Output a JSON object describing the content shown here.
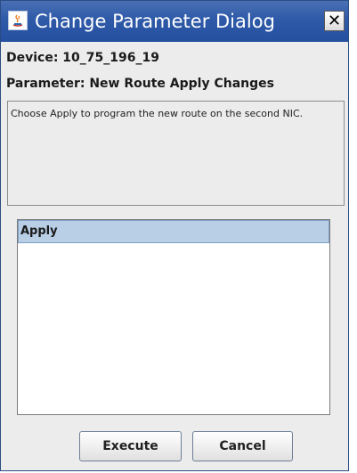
{
  "window": {
    "title": "Change Parameter Dialog",
    "close_glyph": "✕",
    "icon": "java-app-icon"
  },
  "device": {
    "label": "Device: 10_75_196_19"
  },
  "parameter": {
    "label": "Parameter: New Route Apply Changes"
  },
  "description": {
    "text": "Choose Apply to program the new route on the second NIC."
  },
  "options": {
    "items": [
      "Apply"
    ],
    "selected": "Apply"
  },
  "buttons": {
    "execute_label": "Execute",
    "cancel_label": "Cancel"
  },
  "colors": {
    "titlebar": "#2e5aa8",
    "selection": "#b8cfe6",
    "background": "#ececec"
  }
}
